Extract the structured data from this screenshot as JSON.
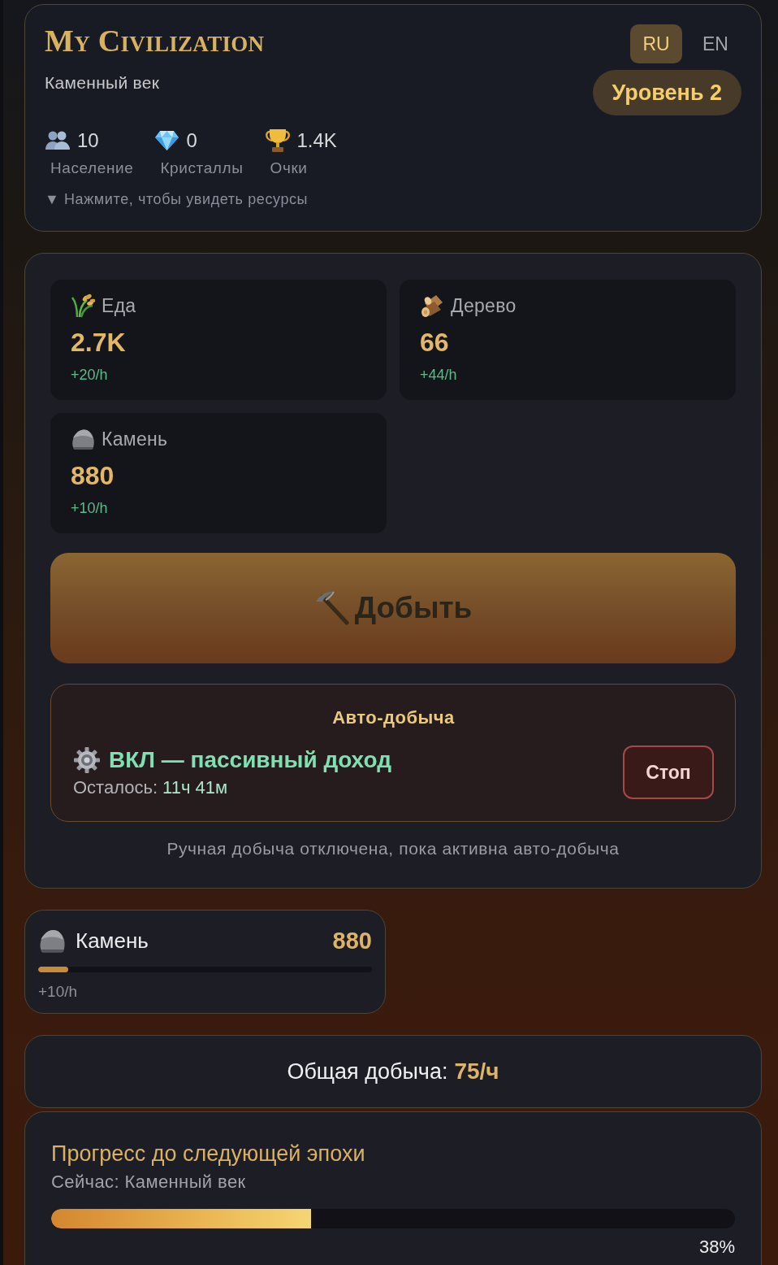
{
  "header": {
    "title": "My Civilization",
    "subtitle": "Каменный век",
    "languages": [
      {
        "label": "RU",
        "selected": true
      },
      {
        "label": "EN",
        "selected": false
      }
    ],
    "level_badge": "Уровень 2",
    "stats": [
      {
        "kind": "population",
        "value": "10",
        "label": "Население"
      },
      {
        "kind": "crystals",
        "value": "0",
        "label": "Кристаллы"
      },
      {
        "kind": "score",
        "value": "1.4K",
        "label": "Очки"
      }
    ],
    "resources_toggle": "▼ Нажмите, чтобы увидеть ресурсы"
  },
  "resources": [
    {
      "kind": "food",
      "name": "Еда",
      "amount": "2.7K",
      "rate": "+20/h"
    },
    {
      "kind": "wood",
      "name": "Дерево",
      "amount": "66",
      "rate": "+44/h"
    },
    {
      "kind": "stone",
      "name": "Камень",
      "amount": "880",
      "rate": "+10/h"
    }
  ],
  "mine_button": {
    "label": "Добыть",
    "disabled": true
  },
  "auto_mining": {
    "title": "Авто-добыча",
    "status": "ВКЛ — пассивный доход",
    "remaining_label": "Осталось:",
    "remaining": "11ч 41м",
    "stop_button": "Стоп"
  },
  "manual_note": "Ручная добыча отключена, пока активна авто-добыча",
  "selected_resource": {
    "kind": "stone",
    "name": "Камень",
    "amount": "880",
    "level": 0.09,
    "rate": "+10/h"
  },
  "total_production": {
    "label": "Общая добыча:",
    "value": "75/ч"
  },
  "era_progress": {
    "title": "Прогресс до следующей эпохи",
    "current": "Сейчас: Каменный век",
    "level": 0.38,
    "percent": "38%"
  }
}
